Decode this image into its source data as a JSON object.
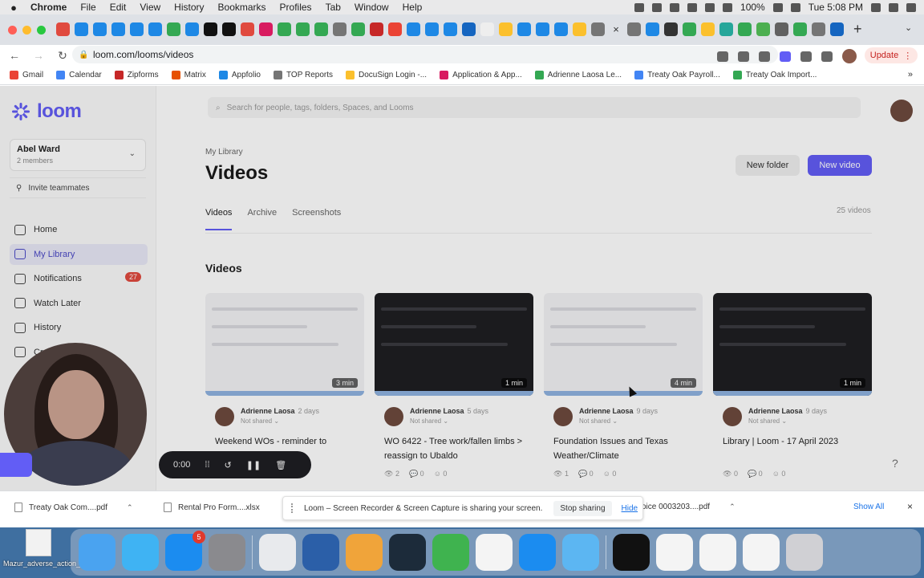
{
  "menubar": {
    "apple": "",
    "items": [
      "Chrome",
      "File",
      "Edit",
      "View",
      "History",
      "Bookmarks",
      "Profiles",
      "Tab",
      "Window",
      "Help"
    ],
    "battery": "100%",
    "clock": "Tue 5:08 PM"
  },
  "browser": {
    "url": "loom.com/looms/videos",
    "update_label": "Update",
    "tab_close": "×",
    "new_tab": "+"
  },
  "bookmarks": [
    {
      "label": "Gmail",
      "color": "#ea4335"
    },
    {
      "label": "Calendar",
      "color": "#4285f4"
    },
    {
      "label": "Zipforms",
      "color": "#c62828"
    },
    {
      "label": "Matrix",
      "color": "#e65100"
    },
    {
      "label": "Appfolio",
      "color": "#1e88e5"
    },
    {
      "label": "TOP Reports",
      "color": "#757575"
    },
    {
      "label": "DocuSign Login -...",
      "color": "#fbc02d"
    },
    {
      "label": "Application & App...",
      "color": "#d81b60"
    },
    {
      "label": "Adrienne Laosa Le...",
      "color": "#34a853"
    },
    {
      "label": "Treaty Oak Payroll...",
      "color": "#4285f4"
    },
    {
      "label": "Treaty Oak Import...",
      "color": "#34a853"
    }
  ],
  "sidebar": {
    "logo_text": "loom",
    "workspace_name": "Abel Ward",
    "workspace_members": "2 members",
    "invite_label": "Invite teammates",
    "nav": [
      {
        "label": "Home",
        "icon": "home-icon"
      },
      {
        "label": "My Library",
        "icon": "library-icon",
        "active": true
      },
      {
        "label": "Notifications",
        "icon": "bell-icon",
        "badge": "27"
      },
      {
        "label": "Watch Later",
        "icon": "bookmark-icon"
      },
      {
        "label": "History",
        "icon": "history-icon"
      },
      {
        "label": "Cr",
        "icon": "globe-icon"
      }
    ]
  },
  "main": {
    "search_placeholder": "Search for people, tags, folders, Spaces, and Looms",
    "breadcrumb": "My Library",
    "title": "Videos",
    "new_folder": "New folder",
    "new_video": "New video",
    "tabs": [
      "Videos",
      "Archive",
      "Screenshots"
    ],
    "video_count": "25 videos",
    "section_heading": "Videos",
    "cards": [
      {
        "author": "Adrienne Laosa",
        "time": "2 days",
        "share": "Not shared",
        "title": "Weekend WOs - reminder to",
        "duration": "3 min",
        "views": "",
        "comments": "",
        "reactions": "",
        "dark": false
      },
      {
        "author": "Adrienne Laosa",
        "time": "5 days",
        "share": "Not shared",
        "title": "WO 6422 - Tree work/fallen limbs > reassign to Ubaldo",
        "duration": "1 min",
        "views": "2",
        "comments": "0",
        "reactions": "0",
        "dark": true
      },
      {
        "author": "Adrienne Laosa",
        "time": "9 days",
        "share": "Not shared",
        "title": "Foundation Issues and Texas Weather/Climate",
        "duration": "4 min",
        "views": "1",
        "comments": "0",
        "reactions": "0",
        "dark": false
      },
      {
        "author": "Adrienne Laosa",
        "time": "9 days",
        "share": "Not shared",
        "title": "Library | Loom - 17 April 2023",
        "duration": "1 min",
        "views": "0",
        "comments": "0",
        "reactions": "0",
        "dark": true
      }
    ],
    "help": "?"
  },
  "recorder": {
    "timer": "0:00"
  },
  "downloads": {
    "items": [
      "Treaty Oak Com....pdf",
      "Rental Pro Form....xlsx",
      "oice 0003203....pdf"
    ],
    "share_message": "Loom – Screen Recorder & Screen Capture is sharing your screen.",
    "stop_sharing": "Stop sharing",
    "hide": "Hide",
    "show_all": "Show All",
    "close": "×"
  },
  "desktop": {
    "file_label": "Mazur_adverse_action_letter.pdf"
  },
  "dock": {
    "apps": [
      {
        "icon": "finder-icon",
        "color": "#4aa3f0"
      },
      {
        "icon": "messages-icon",
        "color": "#3fb3f3"
      },
      {
        "icon": "app-store-icon",
        "color": "#1b8cf0",
        "badge": "5"
      },
      {
        "icon": "system-settings-icon",
        "color": "#8a8a8e"
      },
      {
        "icon": "chrome-icon",
        "color": "#e8eaed"
      },
      {
        "icon": "quicktime-icon",
        "color": "#2b5fa8"
      },
      {
        "icon": "pages-icon",
        "color": "#f0a43a"
      },
      {
        "icon": "webex-icon",
        "color": "#1c2b3a"
      },
      {
        "icon": "numbers-icon",
        "color": "#3fb34f"
      },
      {
        "icon": "document-icon",
        "color": "#f4f4f4"
      },
      {
        "icon": "app-store-icon",
        "color": "#1b8cf0"
      },
      {
        "icon": "folder-icon",
        "color": "#5cb6f2"
      },
      {
        "icon": "screen-icon",
        "color": "#111111"
      },
      {
        "icon": "document-icon",
        "color": "#f4f4f4"
      },
      {
        "icon": "document-icon",
        "color": "#f4f4f4"
      },
      {
        "icon": "document-icon",
        "color": "#f4f4f4"
      },
      {
        "icon": "trash-icon",
        "color": "#d0d0d4"
      }
    ]
  },
  "colors": {
    "accent": "#625df5",
    "badge": "#e04a3f",
    "update_text": "#c5221f"
  }
}
